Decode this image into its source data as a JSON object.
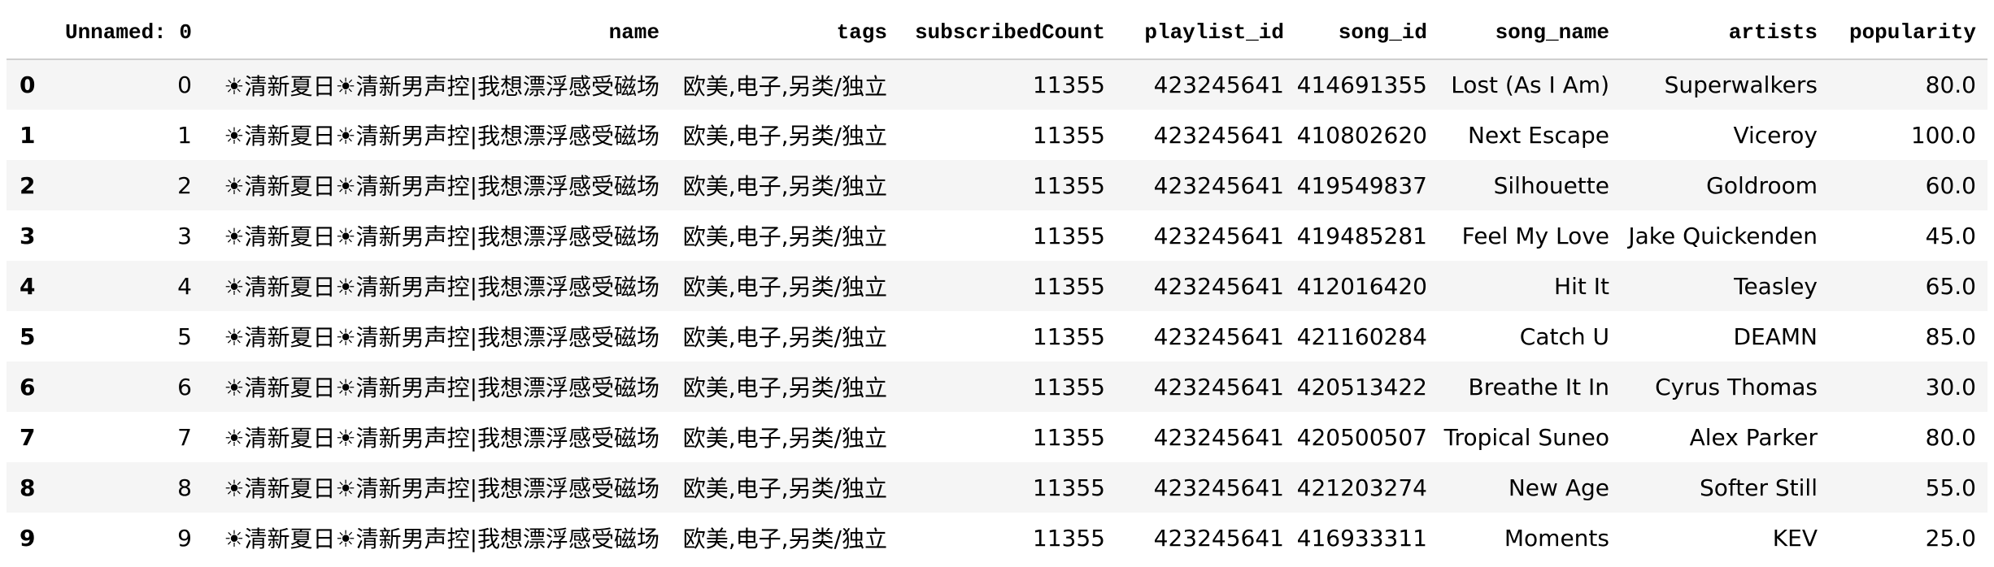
{
  "table": {
    "index_header": "",
    "columns": [
      "Unnamed: 0",
      "name",
      "tags",
      "subscribedCount",
      "playlist_id",
      "song_id",
      "song_name",
      "artists",
      "popularity"
    ],
    "rows": [
      {
        "index": "0",
        "cells": [
          "0",
          "☀清新夏日☀清新男声控|我想漂浮感受磁场",
          "欧美,电子,另类/独立",
          "11355",
          "423245641",
          "414691355",
          "Lost (As I Am)",
          "Superwalkers",
          "80.0"
        ]
      },
      {
        "index": "1",
        "cells": [
          "1",
          "☀清新夏日☀清新男声控|我想漂浮感受磁场",
          "欧美,电子,另类/独立",
          "11355",
          "423245641",
          "410802620",
          "Next Escape",
          "Viceroy",
          "100.0"
        ]
      },
      {
        "index": "2",
        "cells": [
          "2",
          "☀清新夏日☀清新男声控|我想漂浮感受磁场",
          "欧美,电子,另类/独立",
          "11355",
          "423245641",
          "419549837",
          "Silhouette",
          "Goldroom",
          "60.0"
        ]
      },
      {
        "index": "3",
        "cells": [
          "3",
          "☀清新夏日☀清新男声控|我想漂浮感受磁场",
          "欧美,电子,另类/独立",
          "11355",
          "423245641",
          "419485281",
          "Feel My Love",
          "Jake Quickenden",
          "45.0"
        ]
      },
      {
        "index": "4",
        "cells": [
          "4",
          "☀清新夏日☀清新男声控|我想漂浮感受磁场",
          "欧美,电子,另类/独立",
          "11355",
          "423245641",
          "412016420",
          "Hit It",
          "Teasley",
          "65.0"
        ]
      },
      {
        "index": "5",
        "cells": [
          "5",
          "☀清新夏日☀清新男声控|我想漂浮感受磁场",
          "欧美,电子,另类/独立",
          "11355",
          "423245641",
          "421160284",
          "Catch U",
          "DEAMN",
          "85.0"
        ]
      },
      {
        "index": "6",
        "cells": [
          "6",
          "☀清新夏日☀清新男声控|我想漂浮感受磁场",
          "欧美,电子,另类/独立",
          "11355",
          "423245641",
          "420513422",
          "Breathe It In",
          "Cyrus Thomas",
          "30.0"
        ]
      },
      {
        "index": "7",
        "cells": [
          "7",
          "☀清新夏日☀清新男声控|我想漂浮感受磁场",
          "欧美,电子,另类/独立",
          "11355",
          "423245641",
          "420500507",
          "Tropical Suneo",
          "Alex Parker",
          "80.0"
        ]
      },
      {
        "index": "8",
        "cells": [
          "8",
          "☀清新夏日☀清新男声控|我想漂浮感受磁场",
          "欧美,电子,另类/独立",
          "11355",
          "423245641",
          "421203274",
          "New Age",
          "Softer Still",
          "55.0"
        ]
      },
      {
        "index": "9",
        "cells": [
          "9",
          "☀清新夏日☀清新男声控|我想漂浮感受磁场",
          "欧美,电子,另类/独立",
          "11355",
          "423245641",
          "416933311",
          "Moments",
          "KEV",
          "25.0"
        ]
      }
    ]
  },
  "colors": {
    "row_stripe": "#f5f5f5",
    "row_plain": "#ffffff",
    "header_rule": "#cfcfcf",
    "text": "#000000"
  }
}
